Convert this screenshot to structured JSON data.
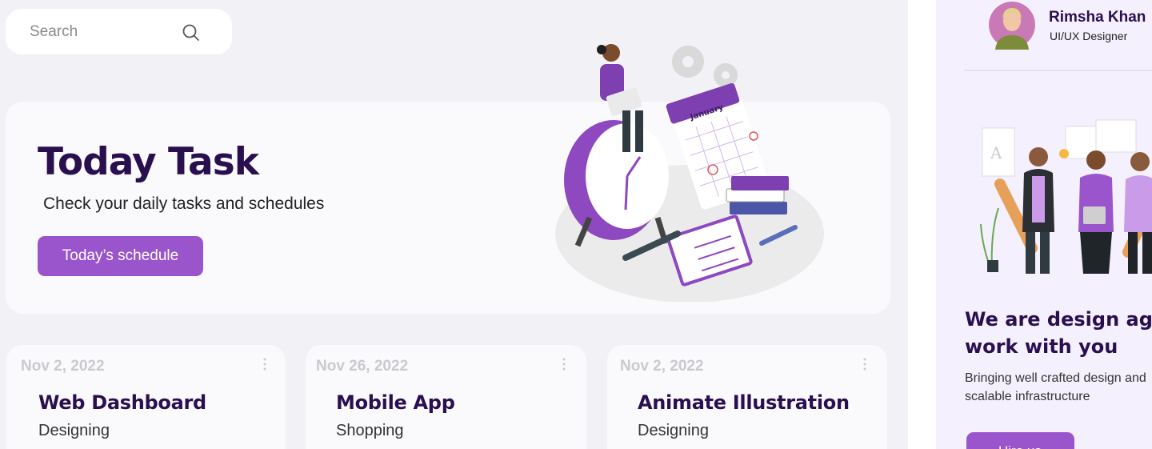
{
  "search": {
    "placeholder": "Search",
    "icon": "search-icon"
  },
  "hero": {
    "title": "Today Task",
    "subtitle": "Check your daily tasks and schedules",
    "button_label": "Today’s schedule",
    "calendar_label": "January"
  },
  "cards": [
    {
      "date": "Nov 2, 2022",
      "title": "Web Dashboard",
      "category": "Designing"
    },
    {
      "date": "Nov 26, 2022",
      "title": "Mobile App",
      "category": "Shopping"
    },
    {
      "date": "Nov 2, 2022",
      "title": "Animate Illustration",
      "category": "Designing"
    }
  ],
  "profile": {
    "name": "Rimsha Khan",
    "role": "UI/UX Designer"
  },
  "promo": {
    "title_line1": "We are design agenc",
    "title_line2": "work with you",
    "text_line1": "Bringing well crafted design and",
    "text_line2": "scalable infrastructure",
    "button_label": "Hire us"
  },
  "colors": {
    "accent": "#9a55cc",
    "heading": "#2a0f4f",
    "background": "#f1f1f6",
    "panel": "#f5f0fd"
  }
}
